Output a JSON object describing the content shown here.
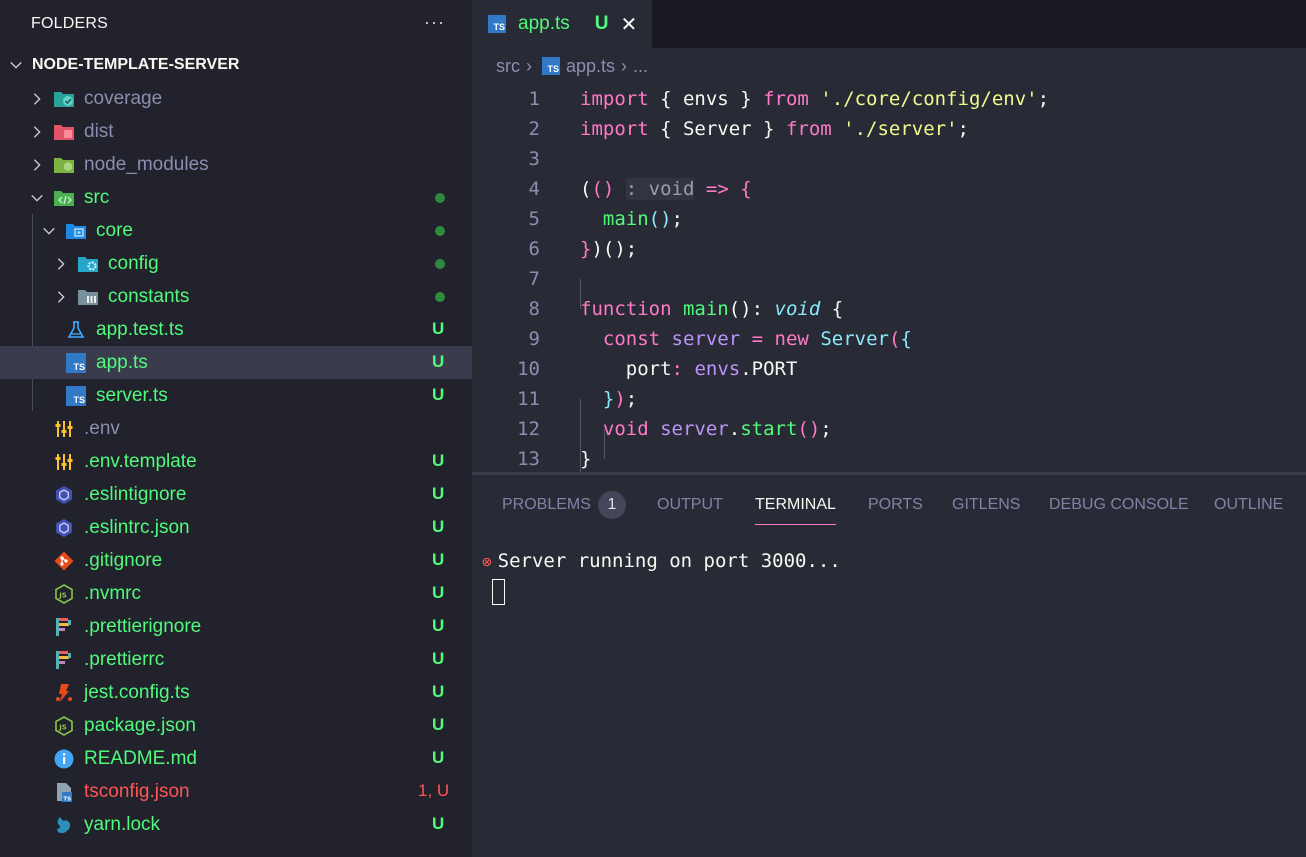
{
  "sidebar": {
    "header": "FOLDERS",
    "more": "···",
    "root": "NODE-TEMPLATE-SERVER",
    "items": [
      {
        "label": "coverage",
        "status": ""
      },
      {
        "label": "dist",
        "status": ""
      },
      {
        "label": "node_modules",
        "status": ""
      },
      {
        "label": "src",
        "status": "dot"
      },
      {
        "label": "core",
        "status": "dot"
      },
      {
        "label": "config",
        "status": "dot"
      },
      {
        "label": "constants",
        "status": "dot"
      },
      {
        "label": "app.test.ts",
        "status": "U"
      },
      {
        "label": "app.ts",
        "status": "U"
      },
      {
        "label": "server.ts",
        "status": "U"
      },
      {
        "label": ".env",
        "status": ""
      },
      {
        "label": ".env.template",
        "status": "U"
      },
      {
        "label": ".eslintignore",
        "status": "U"
      },
      {
        "label": ".eslintrc.json",
        "status": "U"
      },
      {
        "label": ".gitignore",
        "status": "U"
      },
      {
        "label": ".nvmrc",
        "status": "U"
      },
      {
        "label": ".prettierignore",
        "status": "U"
      },
      {
        "label": ".prettierrc",
        "status": "U"
      },
      {
        "label": "jest.config.ts",
        "status": "U"
      },
      {
        "label": "package.json",
        "status": "U"
      },
      {
        "label": "README.md",
        "status": "U"
      },
      {
        "label": "tsconfig.json",
        "status": "1, U"
      },
      {
        "label": "yarn.lock",
        "status": "U"
      }
    ]
  },
  "editor": {
    "tab": {
      "label": "app.ts",
      "status": "U",
      "close": "✕",
      "badge": "TS"
    },
    "breadcrumb": {
      "folder": "src",
      "sep": "›",
      "file": "app.ts",
      "more": "..."
    },
    "line_numbers": [
      "1",
      "2",
      "3",
      "4",
      "5",
      "6",
      "7",
      "8",
      "9",
      "10",
      "11",
      "12",
      "13"
    ],
    "code": {
      "import": "import",
      "from": "from",
      "envs": "envs",
      "Server": "Server",
      "env_path": "'./core/config/env'",
      "server_path": "'./server'",
      "void_hint": ": void",
      "arrow": "=>",
      "main": "main",
      "function": "function",
      "void": "void",
      "const": "const",
      "server": "server",
      "new": "new",
      "port": "port",
      "PORT": "PORT",
      "start": "start"
    }
  },
  "panel": {
    "tabs": [
      "PROBLEMS",
      "OUTPUT",
      "TERMINAL",
      "PORTS",
      "GITLENS",
      "DEBUG CONSOLE",
      "OUTLINE"
    ],
    "problems_count": "1",
    "active_tab": "TERMINAL",
    "terminal_line": "Server running on port 3000..."
  },
  "colors": {
    "background": "#21222c",
    "editor_bg": "#282a36",
    "green": "#50fa7b",
    "pink": "#ff79c6",
    "yellow": "#f1fa8c",
    "cyan": "#8be9fd",
    "purple": "#bd93f9",
    "red": "#ff5555"
  }
}
